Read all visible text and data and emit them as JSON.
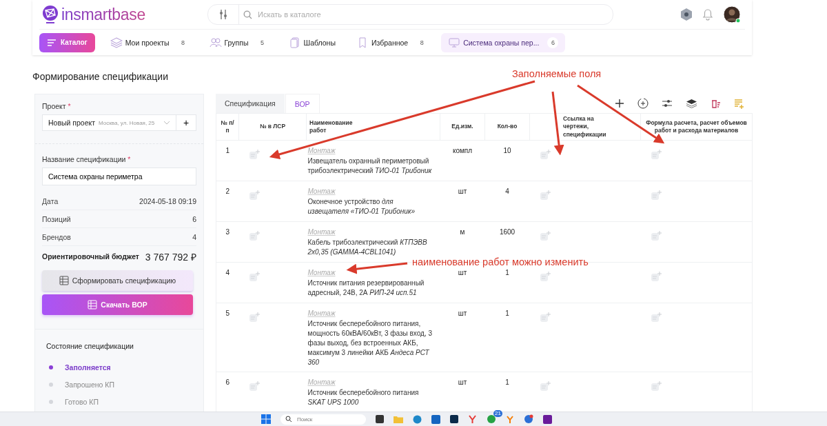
{
  "header": {
    "logo": "insmartbase",
    "search": {
      "placeholder": "Искать в каталоге"
    }
  },
  "nav": [
    {
      "label": "Каталог",
      "kind": "button",
      "selected": false
    },
    {
      "label": "Мои проекты",
      "count": "8",
      "kind": "tab",
      "selected": false
    },
    {
      "label": "Группы",
      "count": "5",
      "kind": "tab",
      "selected": false
    },
    {
      "label": "Шаблоны",
      "kind": "tab",
      "selected": false
    },
    {
      "label": "Избранное",
      "count": "8",
      "kind": "tab",
      "selected": false
    },
    {
      "label": "Система охраны пер...",
      "count": "6",
      "kind": "tab",
      "selected": true
    }
  ],
  "page_title": "Формирование спецификации",
  "sidebar": {
    "project": {
      "label": "Проект",
      "required_mark": "*",
      "value": "Новый проект",
      "hint": "Москва, ул. Новая, 25",
      "add": "+"
    },
    "spec_name": {
      "label": "Название спецификации",
      "required_mark": "*",
      "value": "Система охраны периметра"
    },
    "stats": [
      {
        "label": "Дата",
        "value": "2024-05-18 09:19"
      },
      {
        "label": "Позиций",
        "value": "6"
      },
      {
        "label": "Брендов",
        "value": "4"
      }
    ],
    "budget": {
      "label": "Ориентировочный бюджет",
      "value": "3 767 792 ₽"
    },
    "buttons": [
      {
        "label": "Сформировать спецификацию",
        "kind": "secondary"
      },
      {
        "label": "Скачать ВОР",
        "kind": "primary"
      }
    ],
    "status": {
      "title": "Состояние спецификации",
      "steps": [
        {
          "label": "Заполняется",
          "selected": true
        },
        {
          "label": "Запрошено КП",
          "selected": false
        },
        {
          "label": "Готово КП",
          "selected": false
        }
      ]
    }
  },
  "tabs": [
    {
      "label": "Спецификация",
      "selected": false
    },
    {
      "label": "ВОР",
      "selected": true
    }
  ],
  "table": {
    "columns": [
      "№ п/п",
      "№ в ЛСР",
      "Наименование работ",
      "Ед.изм.",
      "Кол-во",
      "Ссылка на чертежи, спецификации",
      "Формула расчета, расчет объемов работ и расхода материалов"
    ],
    "rows": [
      {
        "n": "1",
        "category": "Монтаж",
        "name": "Извещатель охранный периметровый трибоэлектрический *ТИО-01 Трибоник*",
        "unit": "компл",
        "qty": "10"
      },
      {
        "n": "2",
        "category": "Монтаж",
        "name": "Оконечное устройство *для извещателя «ТИО-01 Трибоник»*",
        "unit": "шт",
        "qty": "4"
      },
      {
        "n": "3",
        "category": "Монтаж",
        "name": "Кабель трибоэлектрический *КТПЭВВ 2х0,35 (GAMMA-4CBL1041)*",
        "unit": "м",
        "qty": "1600"
      },
      {
        "n": "4",
        "category": "Монтаж",
        "name": "Источник питания резервированный адресный, 24В, 2А *РИП-24 исп.51*",
        "unit": "шт",
        "qty": "1"
      },
      {
        "n": "5",
        "category": "Монтаж",
        "name": "Источник бесперебойного питания, мощность 60кВА/60кВт, 3 фазы вход, 3 фазы выход, без встроенных АКБ, максимум 3 линейки АКБ *Андеса РСТ 360*",
        "unit": "шт",
        "qty": "1"
      },
      {
        "n": "6",
        "category": "Монтаж",
        "name": "Источник бесперебойного питания *SKAT UPS 1000*",
        "unit": "шт",
        "qty": "1"
      }
    ]
  },
  "annotations": [
    {
      "text": "Заполняемые поля"
    },
    {
      "text": "наименование работ можно изменить"
    }
  ],
  "taskbar": {
    "search": {
      "placeholder": "Поиск"
    },
    "badge": "21"
  }
}
